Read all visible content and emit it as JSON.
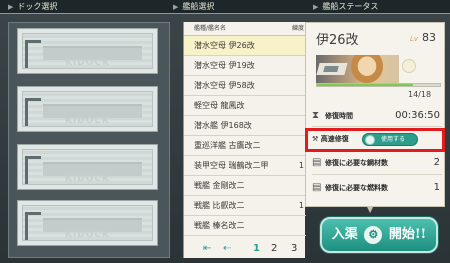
{
  "headers": {
    "dock": "ドック選択",
    "ship": "艦船選択",
    "status": "艦船ステータス"
  },
  "docks": [
    {
      "stencil": "KIDOCK"
    },
    {
      "stencil": "KIDOCK"
    },
    {
      "stencil": "KIDOCK"
    },
    {
      "stencil": "KIDOCK"
    }
  ],
  "ship_list": {
    "col_type_name": "艦種/艦名名",
    "col_lv": "練度",
    "rows": [
      {
        "name": "潜水空母 伊26改",
        "lv": ""
      },
      {
        "name": "潜水空母 伊19改",
        "lv": ""
      },
      {
        "name": "潜水空母 伊58改",
        "lv": ""
      },
      {
        "name": "軽空母 龍鳳改",
        "lv": ""
      },
      {
        "name": "潜水艦 伊168改",
        "lv": ""
      },
      {
        "name": "重巡洋艦 古鷹改二",
        "lv": ""
      },
      {
        "name": "装甲空母 瑞鶴改二甲",
        "lv": "1"
      },
      {
        "name": "戦艦 金剛改二",
        "lv": ""
      },
      {
        "name": "戦艦 比叡改二",
        "lv": "1"
      },
      {
        "name": "戦艦 榛名改二",
        "lv": ""
      }
    ]
  },
  "pager": {
    "first": "⇤",
    "prev": "⇠",
    "pages": [
      "1",
      "2",
      "3"
    ]
  },
  "status": {
    "ship_name": "伊26改",
    "lv_label": "Lv",
    "lv_value": "83",
    "hp_text": "14/18",
    "hp_fraction": 0.78,
    "repair_time_label": "修復時間",
    "repair_time_value": "00:36:50",
    "fast_repair_label": "高速修復",
    "fast_repair_toggle": "使用する",
    "steel_label": "修復に必要な鋼材数",
    "steel_value": "2",
    "fuel_label": "修復に必要な燃料数",
    "fuel_value": "1"
  },
  "start_button": {
    "left": "入渠",
    "right": "開始!!"
  },
  "colors": {
    "accent_teal": "#2d9e8c",
    "highlight_red": "#e11c1c",
    "hp_green": "#7ecb50"
  }
}
